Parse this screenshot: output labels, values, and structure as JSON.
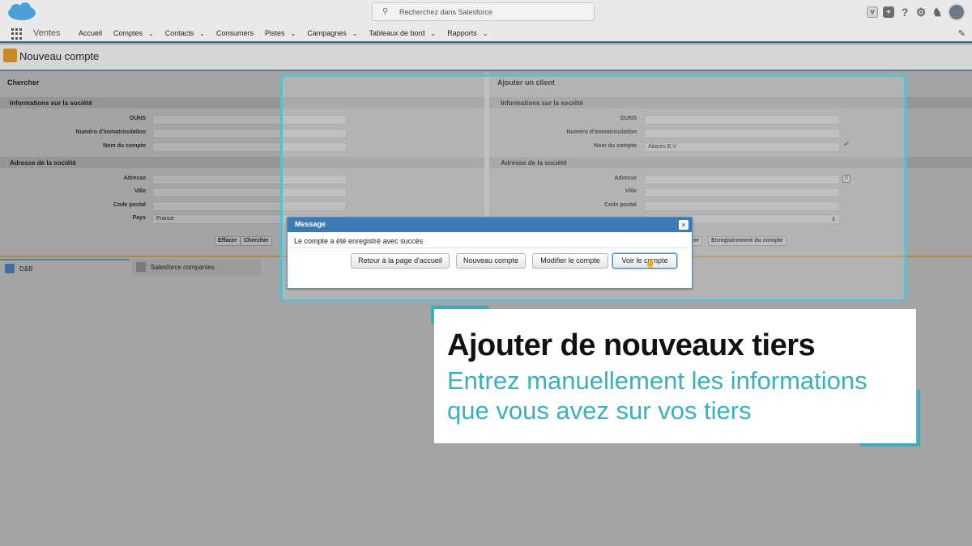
{
  "header": {
    "search_placeholder": "Recherchez dans Salesforce",
    "app_name": "Ventes",
    "nav_items": [
      {
        "label": "Accueil",
        "dropdown": false
      },
      {
        "label": "Comptes",
        "dropdown": true
      },
      {
        "label": "Contacts",
        "dropdown": true
      },
      {
        "label": "Consumers",
        "dropdown": false
      },
      {
        "label": "Pistes",
        "dropdown": true
      },
      {
        "label": "Campagnes",
        "dropdown": true
      },
      {
        "label": "Tableaux de bord",
        "dropdown": true
      },
      {
        "label": "Rapports",
        "dropdown": true
      }
    ],
    "icons": [
      "cloud-logo",
      "search-icon",
      "favorites-icon",
      "add-icon",
      "help-icon",
      "setup-gear-icon",
      "notifications-bell-icon",
      "user-avatar",
      "edit-pencil-icon"
    ]
  },
  "page": {
    "title": "Nouveau compte"
  },
  "left_panel": {
    "title": "Chercher",
    "section_company": "Informations sur la société",
    "duns_label": "DUNS",
    "registration_label": "Numéro d'immatriculation",
    "account_name_label": "Nom du compte",
    "section_address": "Adresse de la société",
    "address_label": "Adresse",
    "city_label": "Ville",
    "postal_label": "Code postal",
    "country_label": "Pays",
    "country_value": "France",
    "clear_button": "Effacer",
    "search_button": "Chercher"
  },
  "right_panel": {
    "title": "Ajouter un client",
    "section_company": "Informations sur la société",
    "duns_label": "DUNS",
    "registration_label": "Numéro d'immatriculation",
    "account_name_label": "Nom du compte",
    "account_name_value": "Altares B.V",
    "section_address": "Adresse de la société",
    "address_label": "Adresse",
    "city_label": "Ville",
    "postal_label": "Code postal",
    "clear_button_partial": "acer",
    "save_button": "Enregistrement du compte"
  },
  "tabs": [
    {
      "label": "D&B",
      "active": true
    },
    {
      "label": "Salesforce companies",
      "active": false
    }
  ],
  "dialog": {
    "title": "Message",
    "message": "Le compte a été enregistré avec succès",
    "buttons": {
      "home": "Retour à la page d'accueil",
      "new": "Nouveau compte",
      "edit": "Modifier le compte",
      "view": "Voir le compte"
    }
  },
  "promo": {
    "title": "Ajouter de nouveaux tiers",
    "subtitle_line1": "Entrez manuellement les informations",
    "subtitle_line2": "que vous avez sur vos tiers"
  },
  "colors": {
    "accent_teal": "#3bb0bd",
    "dialog_header": "#3e7ab5",
    "nav_border": "#3e6b95"
  }
}
